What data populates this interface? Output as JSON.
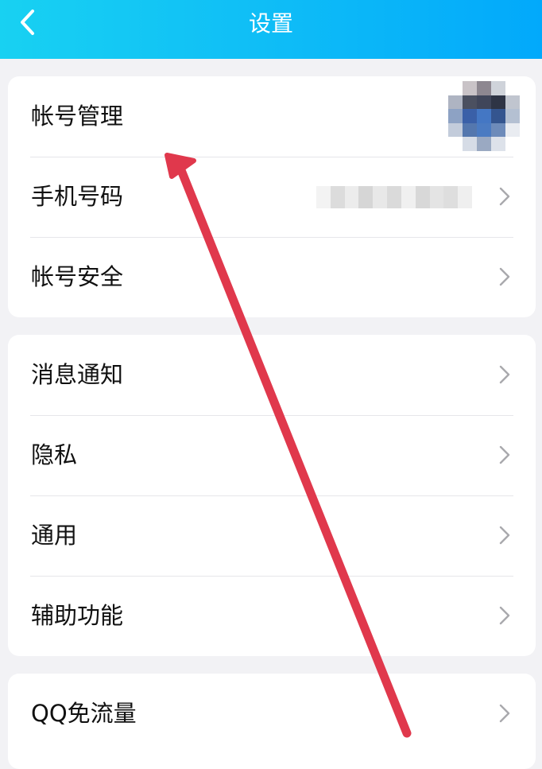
{
  "header": {
    "title": "设置",
    "back_icon": "chevron-left-icon"
  },
  "sections": [
    {
      "items": [
        {
          "label": "帐号管理",
          "trailing": "avatar"
        },
        {
          "label": "手机号码",
          "trailing": "masked-value"
        },
        {
          "label": "帐号安全",
          "trailing": "chevron-right-icon"
        }
      ]
    },
    {
      "items": [
        {
          "label": "消息通知",
          "trailing": "chevron-right-icon"
        },
        {
          "label": "隐私",
          "trailing": "chevron-right-icon"
        },
        {
          "label": "通用",
          "trailing": "chevron-right-icon"
        },
        {
          "label": "辅助功能",
          "trailing": "chevron-right-icon"
        }
      ]
    },
    {
      "items": [
        {
          "label": "QQ免流量",
          "trailing": "chevron-right-icon"
        }
      ]
    }
  ],
  "colors": {
    "header_gradient": [
      "#18d1f2",
      "#02a9fb"
    ],
    "annotation_arrow": "#e0384c",
    "chevron": "#a9a9ad",
    "divider": "#e6e6ea"
  }
}
